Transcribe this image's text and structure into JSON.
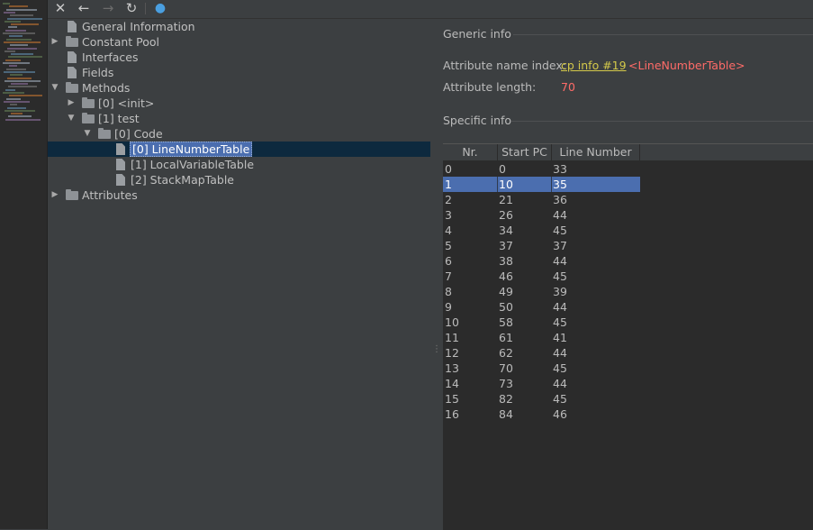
{
  "toolbar": {
    "buttons": [
      {
        "name": "close-icon",
        "glyph": "✕"
      },
      {
        "name": "back-arrow-icon",
        "glyph": "←"
      },
      {
        "name": "forward-arrow-icon",
        "glyph": "→"
      },
      {
        "name": "refresh-icon",
        "glyph": "↻"
      },
      {
        "name": "web-globe-icon",
        "glyph": "●"
      }
    ]
  },
  "tree": {
    "items": [
      {
        "label": "General Information",
        "icon": "file-icon",
        "expand": "none"
      },
      {
        "label": "Constant Pool",
        "icon": "folder-icon",
        "expand": "collapsed"
      },
      {
        "label": "Interfaces",
        "icon": "file-icon",
        "expand": "none"
      },
      {
        "label": "Fields",
        "icon": "file-icon",
        "expand": "none"
      },
      {
        "label": "Methods",
        "icon": "folder-icon",
        "expand": "expanded"
      },
      {
        "label": "[0] <init>",
        "icon": "folder-icon",
        "expand": "collapsed"
      },
      {
        "label": "[1] test",
        "icon": "folder-icon",
        "expand": "expanded"
      },
      {
        "label": "[0] Code",
        "icon": "folder-icon",
        "expand": "expanded"
      },
      {
        "label": "[0] LineNumberTable",
        "icon": "file-icon",
        "expand": "none",
        "selected": true
      },
      {
        "label": "[1] LocalVariableTable",
        "icon": "file-icon",
        "expand": "none"
      },
      {
        "label": "[2] StackMapTable",
        "icon": "file-icon",
        "expand": "none"
      },
      {
        "label": "Attributes",
        "icon": "folder-icon",
        "expand": "collapsed"
      }
    ]
  },
  "generic_info": {
    "title": "Generic info",
    "name_index_label": "Attribute name index:",
    "name_index_link": "cp info #19",
    "name_index_value": "<LineNumberTable>",
    "length_label": "Attribute length:",
    "length_value": "70"
  },
  "specific_info": {
    "title": "Specific info"
  },
  "table": {
    "columns": [
      "Nr.",
      "Start PC",
      "Line Number"
    ],
    "selected_row": 1,
    "rows": [
      [
        "0",
        "0",
        "33"
      ],
      [
        "1",
        "10",
        "35"
      ],
      [
        "2",
        "21",
        "36"
      ],
      [
        "3",
        "26",
        "44"
      ],
      [
        "4",
        "34",
        "45"
      ],
      [
        "5",
        "37",
        "37"
      ],
      [
        "6",
        "38",
        "44"
      ],
      [
        "7",
        "46",
        "45"
      ],
      [
        "8",
        "49",
        "39"
      ],
      [
        "9",
        "50",
        "44"
      ],
      [
        "10",
        "58",
        "45"
      ],
      [
        "11",
        "61",
        "41"
      ],
      [
        "12",
        "62",
        "44"
      ],
      [
        "13",
        "70",
        "45"
      ],
      [
        "14",
        "73",
        "44"
      ],
      [
        "15",
        "82",
        "45"
      ],
      [
        "16",
        "84",
        "46"
      ]
    ]
  }
}
